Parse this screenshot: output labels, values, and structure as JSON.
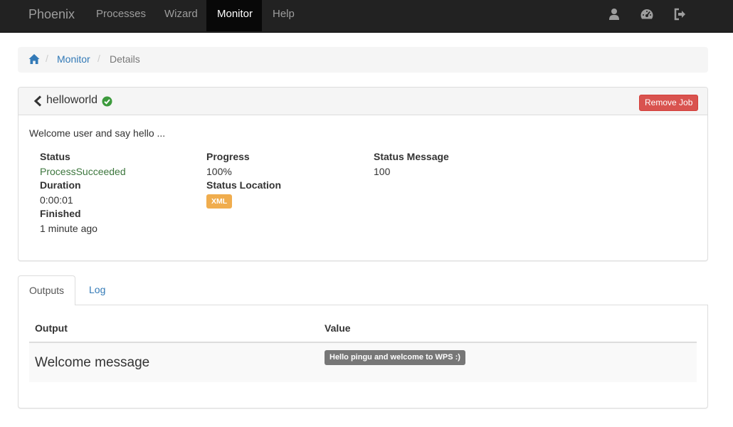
{
  "navbar": {
    "brand": "Phoenix",
    "items": [
      {
        "label": "Processes",
        "active": false
      },
      {
        "label": "Wizard",
        "active": false
      },
      {
        "label": "Monitor",
        "active": true
      },
      {
        "label": "Help",
        "active": false
      }
    ],
    "icons": [
      "user-icon",
      "dashboard-icon",
      "logout-icon"
    ]
  },
  "breadcrumb": {
    "home_icon": "home-icon",
    "separator": "/",
    "items": [
      {
        "label": "Monitor",
        "link": true
      },
      {
        "label": "Details",
        "link": false
      }
    ]
  },
  "job": {
    "title": "helloworld",
    "status_icon": "check-circle-icon",
    "remove_label": "Remove Job",
    "description": "Welcome user and say hello ...",
    "fields": {
      "status": {
        "label": "Status",
        "value": "ProcessSucceeded"
      },
      "duration": {
        "label": "Duration",
        "value": "0:00:01"
      },
      "finished": {
        "label": "Finished",
        "value": "1 minute ago"
      },
      "progress": {
        "label": "Progress",
        "value": "100%"
      },
      "status_location": {
        "label": "Status Location",
        "value": "XML"
      },
      "status_message": {
        "label": "Status Message",
        "value": "100"
      }
    }
  },
  "tabs": [
    {
      "label": "Outputs",
      "active": true
    },
    {
      "label": "Log",
      "active": false
    }
  ],
  "outputs": {
    "columns": [
      "Output",
      "Value"
    ],
    "rows": [
      {
        "output": "Welcome message",
        "value": "Hello pingu and welcome to WPS :)"
      }
    ]
  },
  "colors": {
    "navbar_bg": "#222222",
    "link": "#337ab7",
    "success": "#3c763d",
    "danger": "#d9534f",
    "warning": "#f0ad4e",
    "default_label": "#777777"
  }
}
